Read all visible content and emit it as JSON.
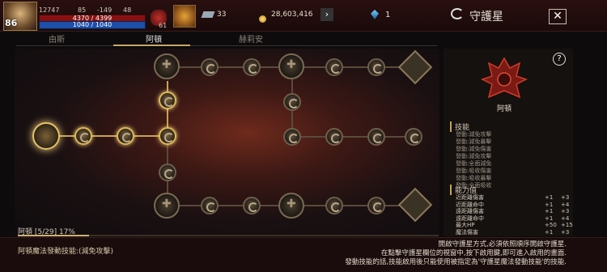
{
  "player": {
    "level": "86",
    "exp_label": "12747",
    "stat_a": "85",
    "stat_b": "-149",
    "stat_c": "48",
    "hp": "4370 / 4399",
    "mp": "1040 / 1040",
    "potion_count": "61"
  },
  "currency": {
    "crystals": "33",
    "gold": "28,603,416",
    "gems": "1"
  },
  "header": {
    "title": "守護星"
  },
  "tabs": [
    {
      "label": "由斯"
    },
    {
      "label": "阿頓",
      "active": true
    },
    {
      "label": "赫莉安"
    }
  ],
  "constellation": {
    "name": "阿頓",
    "progress_label": "阿頓 [5/29] 17%",
    "progress": 0.17
  },
  "skills": {
    "title": "技能",
    "items": [
      "發動:減免攻擊",
      "發動:減免暴擊",
      "發動:減免傷害",
      "發動:減免攻擊",
      "發動:全面減免",
      "發動:吸收傷害",
      "發動:吸收暴擊",
      "發動:全面吸收"
    ]
  },
  "stats": {
    "title": "能力值",
    "rows": [
      {
        "name": "近距離傷害",
        "v1": "+1",
        "v2": "+3"
      },
      {
        "name": "近距離命中",
        "v1": "+1",
        "v2": "+4"
      },
      {
        "name": "遠距離傷害",
        "v1": "+1",
        "v2": "+3"
      },
      {
        "name": "遠距離命中",
        "v1": "+1",
        "v2": "+4"
      },
      {
        "name": "最大HP",
        "v1": "+50",
        "v2": "+15"
      },
      {
        "name": "魔法傷害",
        "v1": "+1",
        "v2": "+3"
      }
    ]
  },
  "bottom": {
    "left_text": "阿頓魔法發動技能:(減免攻擊)",
    "instructions": [
      "開啟守護星方式,必須依照順序開啟守護星.",
      "在點擊守護星欄位的視窗中,按下啟用鍵,即可進入啟用的畫面.",
      "發動技能的話,技能啟用後只能使用被指定為'守護星魔法發動技能'的技能."
    ]
  },
  "icons": [
    "close-icon",
    "help-icon",
    "gold-coin-icon",
    "crystal-icon",
    "gem-icon",
    "chevron-right-icon",
    "guardian-star-icon"
  ]
}
